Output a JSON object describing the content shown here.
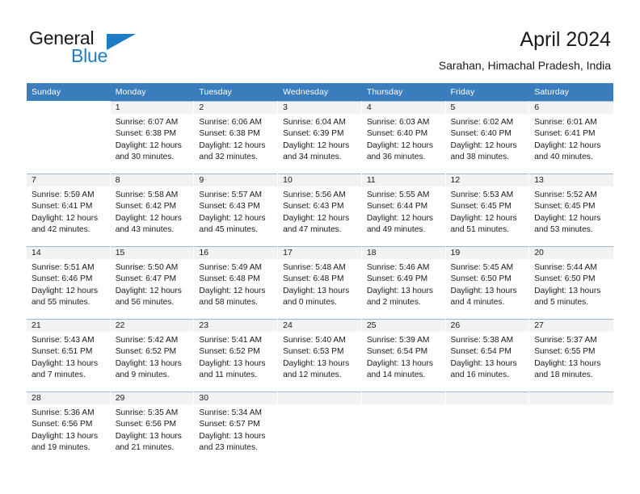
{
  "brand": {
    "line1": "General",
    "line2": "Blue",
    "accent_color": "#1d7cc4",
    "text_color": "#1a1a1a"
  },
  "header": {
    "title": "April 2024",
    "location": "Sarahan, Himachal Pradesh, India"
  },
  "theme": {
    "header_row_bg": "#3a7dbd",
    "header_row_text": "#ffffff",
    "daynum_bar_bg": "#f2f2f2",
    "cell_border": "#9bb8d4",
    "body_text": "#1a1a1a",
    "page_bg": "#ffffff"
  },
  "weekday_headers": [
    "Sunday",
    "Monday",
    "Tuesday",
    "Wednesday",
    "Thursday",
    "Friday",
    "Saturday"
  ],
  "labels": {
    "sunrise_prefix": "Sunrise:",
    "sunset_prefix": "Sunset:",
    "daylight_prefix": "Daylight:"
  },
  "weeks": [
    [
      {
        "day": "",
        "sunrise": "",
        "sunset": "",
        "daylight": "",
        "blank": true
      },
      {
        "day": "1",
        "sunrise": "Sunrise: 6:07 AM",
        "sunset": "Sunset: 6:38 PM",
        "daylight": "Daylight: 12 hours and 30 minutes."
      },
      {
        "day": "2",
        "sunrise": "Sunrise: 6:06 AM",
        "sunset": "Sunset: 6:38 PM",
        "daylight": "Daylight: 12 hours and 32 minutes."
      },
      {
        "day": "3",
        "sunrise": "Sunrise: 6:04 AM",
        "sunset": "Sunset: 6:39 PM",
        "daylight": "Daylight: 12 hours and 34 minutes."
      },
      {
        "day": "4",
        "sunrise": "Sunrise: 6:03 AM",
        "sunset": "Sunset: 6:40 PM",
        "daylight": "Daylight: 12 hours and 36 minutes."
      },
      {
        "day": "5",
        "sunrise": "Sunrise: 6:02 AM",
        "sunset": "Sunset: 6:40 PM",
        "daylight": "Daylight: 12 hours and 38 minutes."
      },
      {
        "day": "6",
        "sunrise": "Sunrise: 6:01 AM",
        "sunset": "Sunset: 6:41 PM",
        "daylight": "Daylight: 12 hours and 40 minutes."
      }
    ],
    [
      {
        "day": "7",
        "sunrise": "Sunrise: 5:59 AM",
        "sunset": "Sunset: 6:41 PM",
        "daylight": "Daylight: 12 hours and 42 minutes."
      },
      {
        "day": "8",
        "sunrise": "Sunrise: 5:58 AM",
        "sunset": "Sunset: 6:42 PM",
        "daylight": "Daylight: 12 hours and 43 minutes."
      },
      {
        "day": "9",
        "sunrise": "Sunrise: 5:57 AM",
        "sunset": "Sunset: 6:43 PM",
        "daylight": "Daylight: 12 hours and 45 minutes."
      },
      {
        "day": "10",
        "sunrise": "Sunrise: 5:56 AM",
        "sunset": "Sunset: 6:43 PM",
        "daylight": "Daylight: 12 hours and 47 minutes."
      },
      {
        "day": "11",
        "sunrise": "Sunrise: 5:55 AM",
        "sunset": "Sunset: 6:44 PM",
        "daylight": "Daylight: 12 hours and 49 minutes."
      },
      {
        "day": "12",
        "sunrise": "Sunrise: 5:53 AM",
        "sunset": "Sunset: 6:45 PM",
        "daylight": "Daylight: 12 hours and 51 minutes."
      },
      {
        "day": "13",
        "sunrise": "Sunrise: 5:52 AM",
        "sunset": "Sunset: 6:45 PM",
        "daylight": "Daylight: 12 hours and 53 minutes."
      }
    ],
    [
      {
        "day": "14",
        "sunrise": "Sunrise: 5:51 AM",
        "sunset": "Sunset: 6:46 PM",
        "daylight": "Daylight: 12 hours and 55 minutes."
      },
      {
        "day": "15",
        "sunrise": "Sunrise: 5:50 AM",
        "sunset": "Sunset: 6:47 PM",
        "daylight": "Daylight: 12 hours and 56 minutes."
      },
      {
        "day": "16",
        "sunrise": "Sunrise: 5:49 AM",
        "sunset": "Sunset: 6:48 PM",
        "daylight": "Daylight: 12 hours and 58 minutes."
      },
      {
        "day": "17",
        "sunrise": "Sunrise: 5:48 AM",
        "sunset": "Sunset: 6:48 PM",
        "daylight": "Daylight: 13 hours and 0 minutes."
      },
      {
        "day": "18",
        "sunrise": "Sunrise: 5:46 AM",
        "sunset": "Sunset: 6:49 PM",
        "daylight": "Daylight: 13 hours and 2 minutes."
      },
      {
        "day": "19",
        "sunrise": "Sunrise: 5:45 AM",
        "sunset": "Sunset: 6:50 PM",
        "daylight": "Daylight: 13 hours and 4 minutes."
      },
      {
        "day": "20",
        "sunrise": "Sunrise: 5:44 AM",
        "sunset": "Sunset: 6:50 PM",
        "daylight": "Daylight: 13 hours and 5 minutes."
      }
    ],
    [
      {
        "day": "21",
        "sunrise": "Sunrise: 5:43 AM",
        "sunset": "Sunset: 6:51 PM",
        "daylight": "Daylight: 13 hours and 7 minutes."
      },
      {
        "day": "22",
        "sunrise": "Sunrise: 5:42 AM",
        "sunset": "Sunset: 6:52 PM",
        "daylight": "Daylight: 13 hours and 9 minutes."
      },
      {
        "day": "23",
        "sunrise": "Sunrise: 5:41 AM",
        "sunset": "Sunset: 6:52 PM",
        "daylight": "Daylight: 13 hours and 11 minutes."
      },
      {
        "day": "24",
        "sunrise": "Sunrise: 5:40 AM",
        "sunset": "Sunset: 6:53 PM",
        "daylight": "Daylight: 13 hours and 12 minutes."
      },
      {
        "day": "25",
        "sunrise": "Sunrise: 5:39 AM",
        "sunset": "Sunset: 6:54 PM",
        "daylight": "Daylight: 13 hours and 14 minutes."
      },
      {
        "day": "26",
        "sunrise": "Sunrise: 5:38 AM",
        "sunset": "Sunset: 6:54 PM",
        "daylight": "Daylight: 13 hours and 16 minutes."
      },
      {
        "day": "27",
        "sunrise": "Sunrise: 5:37 AM",
        "sunset": "Sunset: 6:55 PM",
        "daylight": "Daylight: 13 hours and 18 minutes."
      }
    ],
    [
      {
        "day": "28",
        "sunrise": "Sunrise: 5:36 AM",
        "sunset": "Sunset: 6:56 PM",
        "daylight": "Daylight: 13 hours and 19 minutes."
      },
      {
        "day": "29",
        "sunrise": "Sunrise: 5:35 AM",
        "sunset": "Sunset: 6:56 PM",
        "daylight": "Daylight: 13 hours and 21 minutes."
      },
      {
        "day": "30",
        "sunrise": "Sunrise: 5:34 AM",
        "sunset": "Sunset: 6:57 PM",
        "daylight": "Daylight: 13 hours and 23 minutes."
      },
      {
        "day": "",
        "sunrise": "",
        "sunset": "",
        "daylight": "",
        "empty": true
      },
      {
        "day": "",
        "sunrise": "",
        "sunset": "",
        "daylight": "",
        "empty": true
      },
      {
        "day": "",
        "sunrise": "",
        "sunset": "",
        "daylight": "",
        "empty": true
      },
      {
        "day": "",
        "sunrise": "",
        "sunset": "",
        "daylight": "",
        "empty": true
      }
    ]
  ]
}
